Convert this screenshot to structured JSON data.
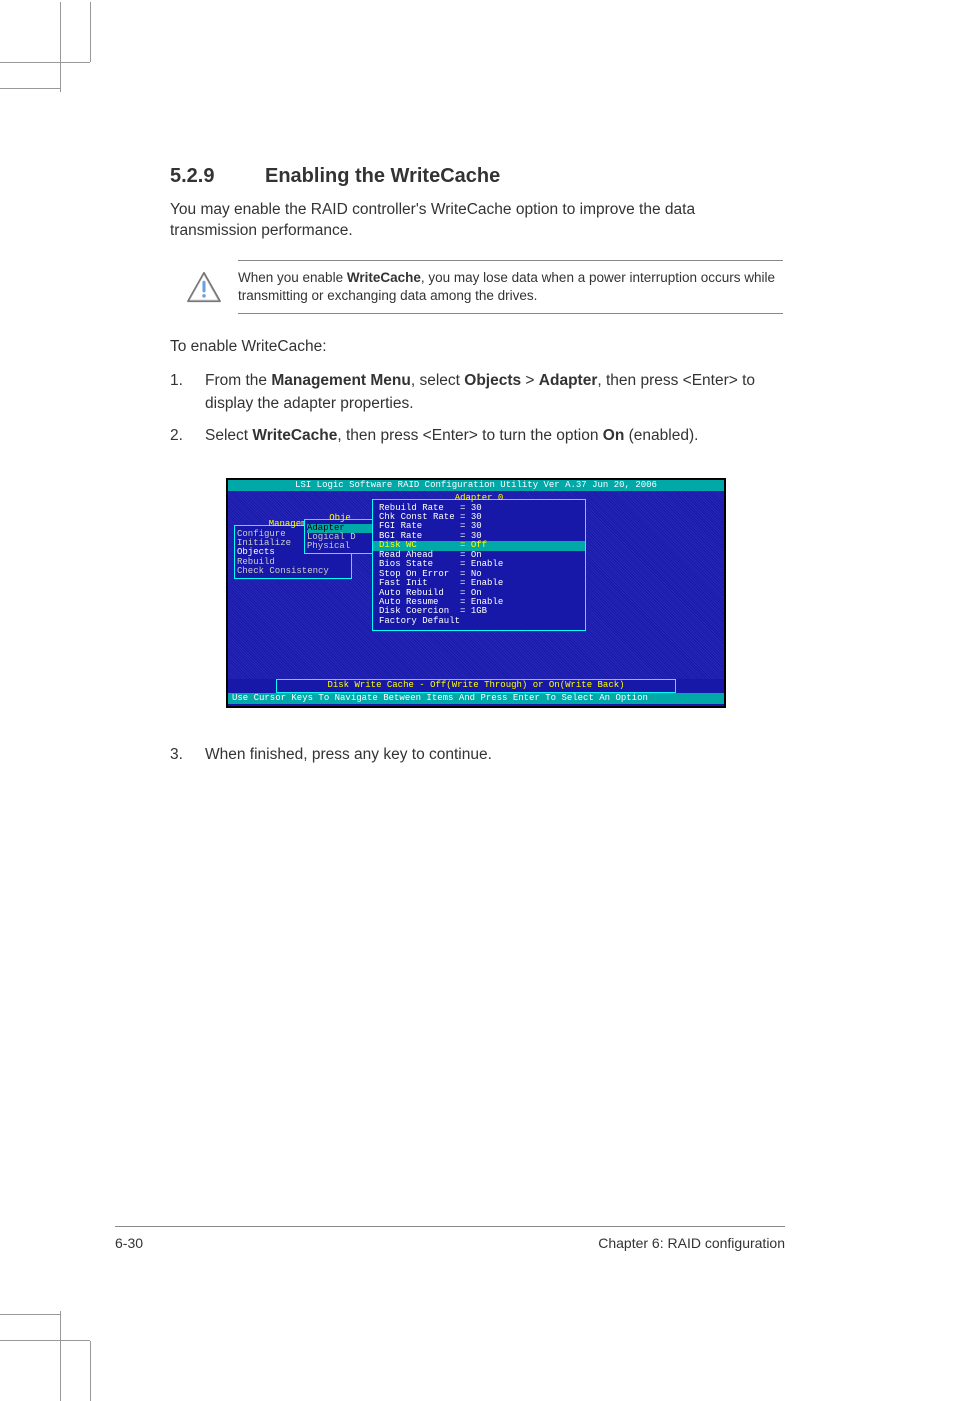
{
  "heading": {
    "number": "5.2.9",
    "title": "Enabling the WriteCache"
  },
  "intro": "You may enable the RAID controller's WriteCache option to improve the data transmission performance.",
  "note": {
    "pre": "When you enable ",
    "bold": "WriteCache",
    "post": ", you may lose data when a power interruption occurs while transmitting or exchanging data among the drives."
  },
  "sub": "To enable WriteCache:",
  "steps": [
    {
      "n": "1.",
      "pre": "From the ",
      "b1": "Management Menu",
      "mid1": ", select ",
      "b2": "Objects",
      "mid2": " > ",
      "b3": "Adapter",
      "post": ", then press <Enter> to display the adapter properties."
    },
    {
      "n": "2.",
      "pre": "Select ",
      "b1": "WriteCache",
      "mid1": ", then press <Enter> to turn the option ",
      "b2": "On",
      "post": " (enabled)."
    }
  ],
  "bios": {
    "titlebar": "LSI Logic Software RAID Configuration Utility Ver A.37 Jun 20, 2006",
    "mgmt": {
      "title": "Managemen",
      "items": [
        "Configure",
        "Initialize",
        "Objects",
        "Rebuild",
        "Check Consistency"
      ],
      "hl_index": 2
    },
    "obj": {
      "title": "Obje",
      "items": [
        "Adapter",
        "Logical D",
        "Physical"
      ],
      "sel_index": 0
    },
    "adapter": {
      "title": "Adapter 0",
      "rows": [
        {
          "k": "Rebuild Rate",
          "v": "= 30"
        },
        {
          "k": "Chk Const Rate",
          "v": "= 30"
        },
        {
          "k": "FGI Rate",
          "v": "= 30"
        },
        {
          "k": "BGI Rate",
          "v": "= 30"
        },
        {
          "k": "Disk WC",
          "v": "= Off",
          "sel": true
        },
        {
          "k": "Read Ahead",
          "v": "= On"
        },
        {
          "k": "Bios State",
          "v": "= Enable"
        },
        {
          "k": "Stop On Error",
          "v": "= No"
        },
        {
          "k": "Fast Init",
          "v": "= Enable"
        },
        {
          "k": "Auto Rebuild",
          "v": "= On"
        },
        {
          "k": "Auto Resume",
          "v": "= Enable"
        },
        {
          "k": "Disk Coercion",
          "v": "= 1GB"
        },
        {
          "k": "Factory Default",
          "v": ""
        }
      ]
    },
    "help": "Disk Write Cache - Off(Write Through) or On(Write Back)",
    "footer": "Use Cursor Keys To Navigate Between Items And Press Enter To Select An Option"
  },
  "step3": {
    "n": "3.",
    "text": "When finished, press any key to continue."
  },
  "footer": {
    "left": "6-30",
    "right": "Chapter 6: RAID configuration"
  }
}
